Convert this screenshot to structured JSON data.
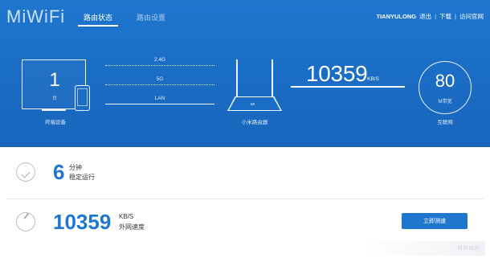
{
  "header": {
    "logo": "MiWiFi",
    "tabs": [
      {
        "label": "路由状态",
        "active": true
      },
      {
        "label": "路由设置",
        "active": false
      }
    ],
    "user": "TIANYULONG",
    "nav": [
      "退出",
      "下载",
      "访问官网"
    ]
  },
  "devices": {
    "count": "1",
    "unit": "台",
    "caption": "终端设备"
  },
  "links": {
    "labels": [
      "2.4G",
      "5G",
      "LAN"
    ]
  },
  "router": {
    "mark": "MI",
    "caption": "小米路由器"
  },
  "speed": {
    "value": "10359",
    "unit": "KB/S"
  },
  "internet": {
    "value": "80",
    "unit": "M带宽",
    "caption": "互联网"
  },
  "uptime": {
    "value": "6",
    "unit": "分钟",
    "label": "稳定运行"
  },
  "wan_speed": {
    "value": "10359",
    "unit": "KB/S",
    "label": "外网速度",
    "button": "立即测速"
  },
  "watermark": "nnnn",
  "colors": {
    "primary": "#1f76cf",
    "header_bg": "#1a6cc4"
  }
}
